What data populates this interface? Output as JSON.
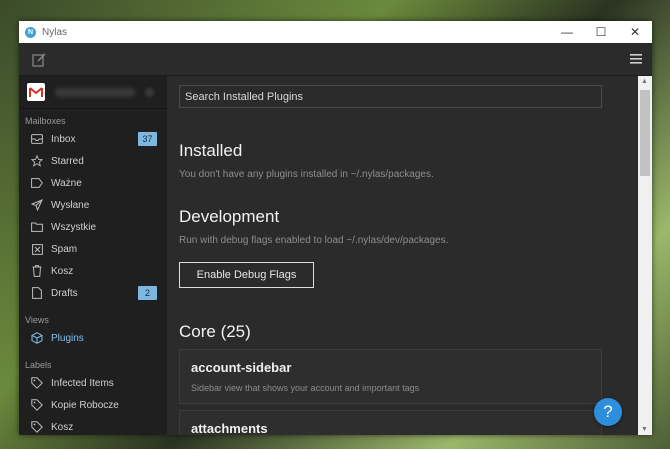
{
  "window": {
    "title": "Nylas",
    "app_icon": "N"
  },
  "sidebar": {
    "sections": {
      "mailboxes": "Mailboxes",
      "views": "Views",
      "labels": "Labels"
    },
    "mailboxes": [
      {
        "label": "Inbox",
        "icon": "inbox-icon",
        "count": "37"
      },
      {
        "label": "Starred",
        "icon": "star-icon"
      },
      {
        "label": "Ważne",
        "icon": "tag-icon"
      },
      {
        "label": "Wysłane",
        "icon": "send-icon"
      },
      {
        "label": "Wszystkie",
        "icon": "folder-icon"
      },
      {
        "label": "Spam",
        "icon": "spam-icon"
      },
      {
        "label": "Kosz",
        "icon": "trash-icon"
      },
      {
        "label": "Drafts",
        "icon": "draft-icon",
        "count": "2"
      }
    ],
    "views": [
      {
        "label": "Plugins",
        "icon": "plugins-icon",
        "active": true
      }
    ],
    "labels": [
      {
        "label": "Infected Items",
        "icon": "label-icon"
      },
      {
        "label": "Kopie Robocze",
        "icon": "label-icon"
      },
      {
        "label": "Kosz",
        "icon": "label-icon"
      }
    ]
  },
  "main": {
    "search_placeholder": "Search Installed Plugins",
    "installed": {
      "title": "Installed",
      "text": "You don't have any plugins installed in ~/.nylas/packages."
    },
    "development": {
      "title": "Development",
      "text": "Run with debug flags enabled to load ~/.nylas/dev/packages.",
      "button": "Enable Debug Flags"
    },
    "core": {
      "title": "Core (25)",
      "plugins": [
        {
          "name": "account-sidebar",
          "description": "Sidebar view that shows your account and important tags"
        },
        {
          "name": "attachments",
          "description": ""
        }
      ]
    }
  },
  "help_button": "?",
  "colors": {
    "accent": "#7fc0ec",
    "badge": "#7db6e0",
    "help": "#2d8fdc"
  }
}
